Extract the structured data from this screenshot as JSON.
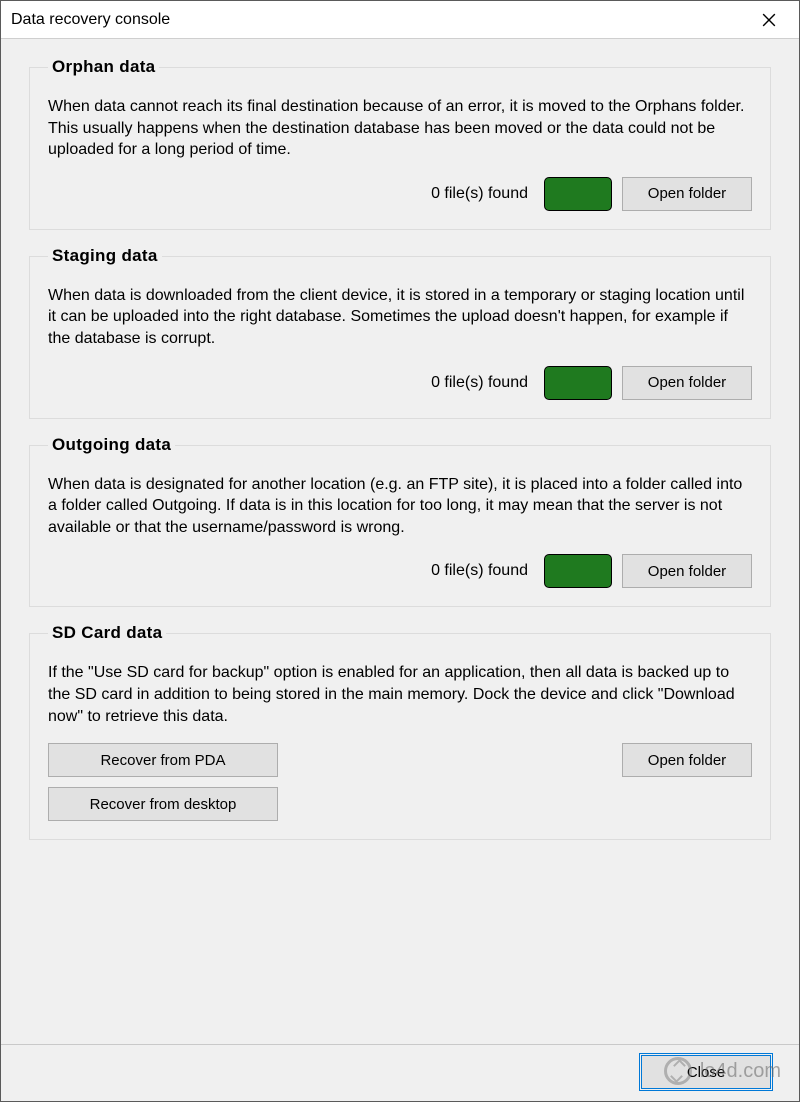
{
  "window": {
    "title": "Data recovery console"
  },
  "sections": {
    "orphan": {
      "title": "Orphan data",
      "desc": "When data cannot reach its final destination because of an error, it is moved to the Orphans folder. This usually happens when the destination database has been moved or the data could not be uploaded for a long period of time.",
      "files_found": "0 file(s) found",
      "open_folder": "Open folder",
      "indicator_color": "#1f7a1f"
    },
    "staging": {
      "title": "Staging data",
      "desc": "When data is downloaded from the client device, it is stored in a temporary or staging location until it can be uploaded into the right database. Sometimes the upload doesn't happen, for example if the database is corrupt.",
      "files_found": "0 file(s) found",
      "open_folder": "Open folder",
      "indicator_color": "#1f7a1f"
    },
    "outgoing": {
      "title": "Outgoing data",
      "desc": "When data is designated for another location (e.g. an FTP site), it is placed into a folder called into a folder called Outgoing. If data is in this location for too long, it may mean that the server is not available or that the username/password is wrong.",
      "files_found": "0 file(s) found",
      "open_folder": "Open folder",
      "indicator_color": "#1f7a1f"
    },
    "sdcard": {
      "title": "SD Card data",
      "desc": "If the \"Use SD card for backup\" option is enabled for an application, then all data is backed up to the SD card in addition to being stored in the main memory. Dock the device and click \"Download now\" to retrieve this data.",
      "recover_pda": "Recover from PDA",
      "recover_desktop": "Recover from desktop",
      "open_folder": "Open folder"
    }
  },
  "footer": {
    "close": "Close"
  },
  "watermark": "lo4d.com"
}
